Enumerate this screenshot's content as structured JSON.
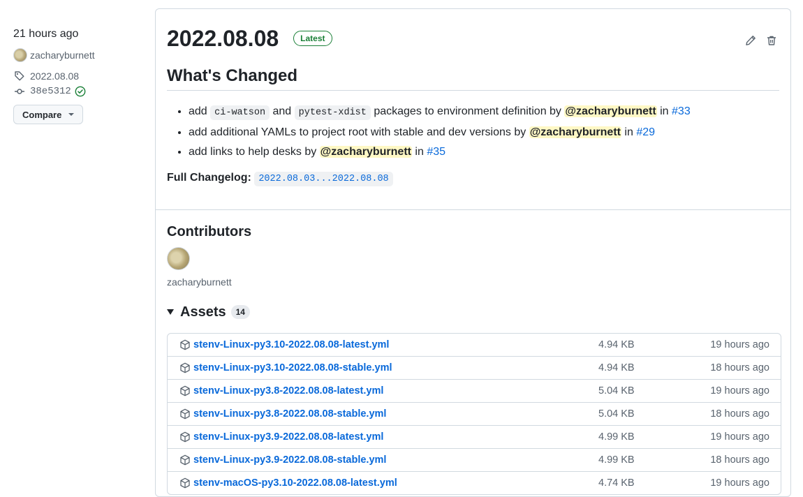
{
  "sidebar": {
    "time": "21 hours ago",
    "author": "zacharyburnett",
    "tag": "2022.08.08",
    "commit": "38e5312",
    "compare_label": "Compare"
  },
  "release": {
    "title": "2022.08.08",
    "badge": "Latest",
    "heading": "What's Changed",
    "changes": [
      {
        "pre": "add ",
        "code1": "ci-watson",
        "mid": " and ",
        "code2": "pytest-xdist",
        "post": " packages to environment definition by ",
        "mention": "@zacharyburnett",
        "in": " in ",
        "pr": "#33"
      },
      {
        "text": "add additional YAMLs to project root with stable and dev versions by ",
        "mention": "@zacharyburnett",
        "in": " in ",
        "pr": "#29"
      },
      {
        "text": "add links to help desks by ",
        "mention": "@zacharyburnett",
        "in": " in ",
        "pr": "#35"
      }
    ],
    "full_changelog_label": "Full Changelog",
    "full_changelog_sep": ":",
    "full_changelog_link": "2022.08.03...2022.08.08"
  },
  "contributors": {
    "heading": "Contributors",
    "names": [
      "zacharyburnett"
    ]
  },
  "assets": {
    "heading": "Assets",
    "count": "14",
    "items": [
      {
        "name": "stenv-Linux-py3.10-2022.08.08-latest.yml",
        "size": "4.94 KB",
        "ago": "19 hours ago"
      },
      {
        "name": "stenv-Linux-py3.10-2022.08.08-stable.yml",
        "size": "4.94 KB",
        "ago": "18 hours ago"
      },
      {
        "name": "stenv-Linux-py3.8-2022.08.08-latest.yml",
        "size": "5.04 KB",
        "ago": "19 hours ago"
      },
      {
        "name": "stenv-Linux-py3.8-2022.08.08-stable.yml",
        "size": "5.04 KB",
        "ago": "18 hours ago"
      },
      {
        "name": "stenv-Linux-py3.9-2022.08.08-latest.yml",
        "size": "4.99 KB",
        "ago": "19 hours ago"
      },
      {
        "name": "stenv-Linux-py3.9-2022.08.08-stable.yml",
        "size": "4.99 KB",
        "ago": "18 hours ago"
      },
      {
        "name": "stenv-macOS-py3.10-2022.08.08-latest.yml",
        "size": "4.74 KB",
        "ago": "19 hours ago"
      }
    ]
  },
  "colors": {
    "link": "#0969da",
    "latest_badge": "#1a7f37",
    "verified": "#1a7f37",
    "mention_bg": "#fff8c5"
  },
  "icons": [
    "tag-icon",
    "commit-icon",
    "verified-check-icon",
    "pencil-icon",
    "trash-icon",
    "package-icon"
  ]
}
